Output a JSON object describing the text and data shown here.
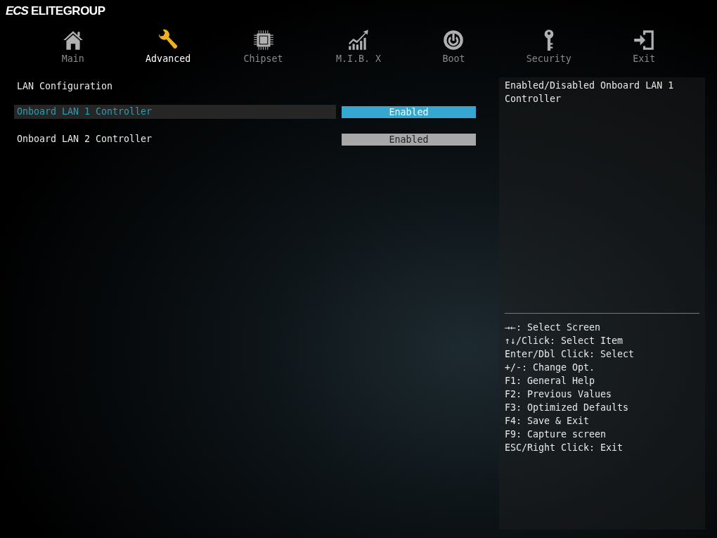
{
  "logo": {
    "mark": "ECS",
    "name": "ELITEGROUP"
  },
  "tabs": [
    {
      "label": "Main",
      "kind": "home",
      "selected": false
    },
    {
      "label": "Advanced",
      "kind": "wrench",
      "selected": true
    },
    {
      "label": "Chipset",
      "kind": "chip",
      "selected": false
    },
    {
      "label": "M.I.B. X",
      "kind": "chart",
      "selected": false
    },
    {
      "label": "Boot",
      "kind": "power",
      "selected": false
    },
    {
      "label": "Security",
      "kind": "key",
      "selected": false
    },
    {
      "label": "Exit",
      "kind": "exit",
      "selected": false
    }
  ],
  "section_title": "LAN Configuration",
  "settings": [
    {
      "label": "Onboard LAN 1 Controller",
      "value": "Enabled",
      "selected": true
    },
    {
      "label": "Onboard LAN 2 Controller",
      "value": "Enabled",
      "selected": false
    }
  ],
  "help_text": "Enabled/Disabled Onboard LAN 1 Controller",
  "key_legend": [
    "→←: Select Screen",
    "↑↓/Click: Select Item",
    "Enter/Dbl Click: Select",
    "+/-: Change Opt.",
    "F1: General Help",
    "F2: Previous Values",
    "F3: Optimized Defaults",
    "F4: Save & Exit",
    "F9: Capture screen",
    "ESC/Right Click: Exit"
  ]
}
